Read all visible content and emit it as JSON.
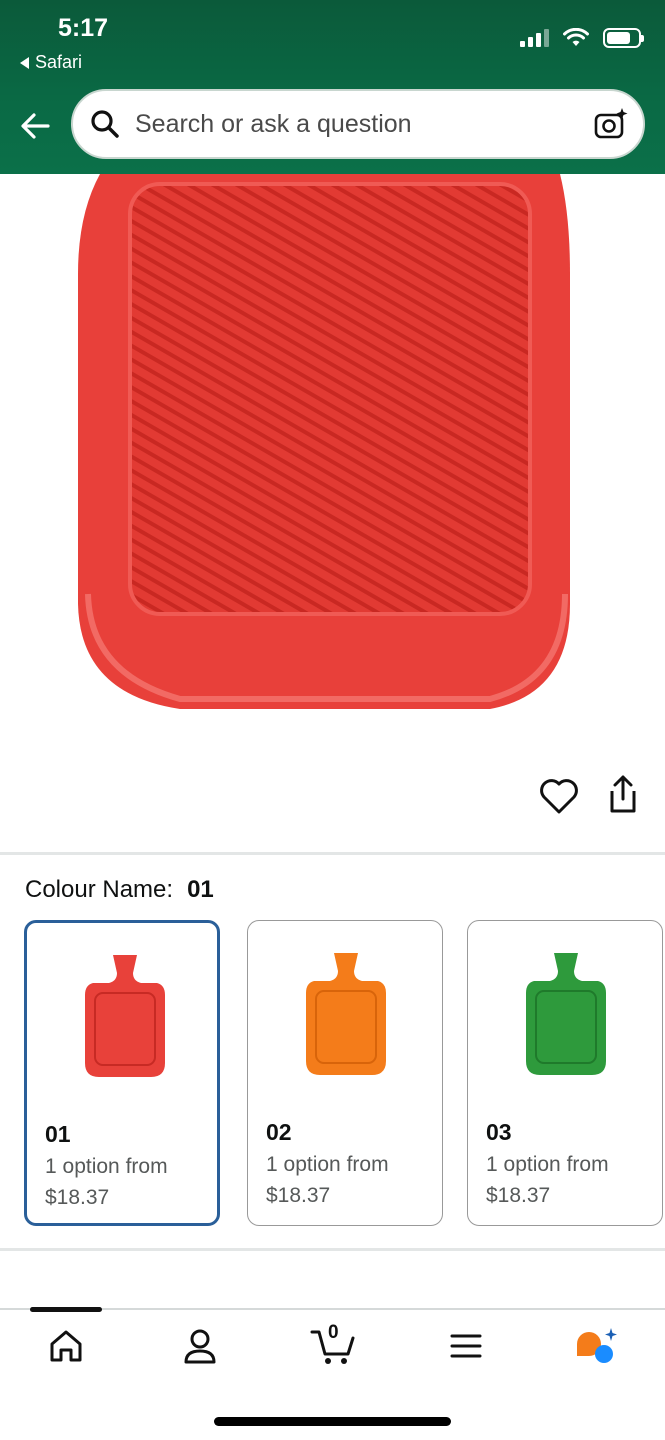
{
  "status_bar": {
    "time": "5:17",
    "back_app": "Safari"
  },
  "search": {
    "placeholder": "Search or ask a question"
  },
  "product": {
    "image_icon": "red-hot-water-bottle",
    "actions": [
      "heart-icon",
      "share-icon"
    ]
  },
  "variation": {
    "label": "Colour Name:",
    "selected_value": "01",
    "options": [
      {
        "code": "01",
        "line1": "1 option from",
        "price": "$18.37",
        "color": "#e8413a",
        "selected": true
      },
      {
        "code": "02",
        "line1": "1 option from",
        "price": "$18.37",
        "color": "#f47c1a",
        "selected": false
      },
      {
        "code": "03",
        "line1": "1 option from",
        "price": "$18.37",
        "color": "#2e9a3c",
        "selected": false
      }
    ]
  },
  "bottom_nav": {
    "items": [
      "home-icon",
      "account-icon",
      "cart-icon",
      "menu-icon",
      "rufus-icon"
    ],
    "cart_count": "0"
  },
  "colors": {
    "header_green": "#0b6a44",
    "selected_border": "#2a5f99"
  }
}
